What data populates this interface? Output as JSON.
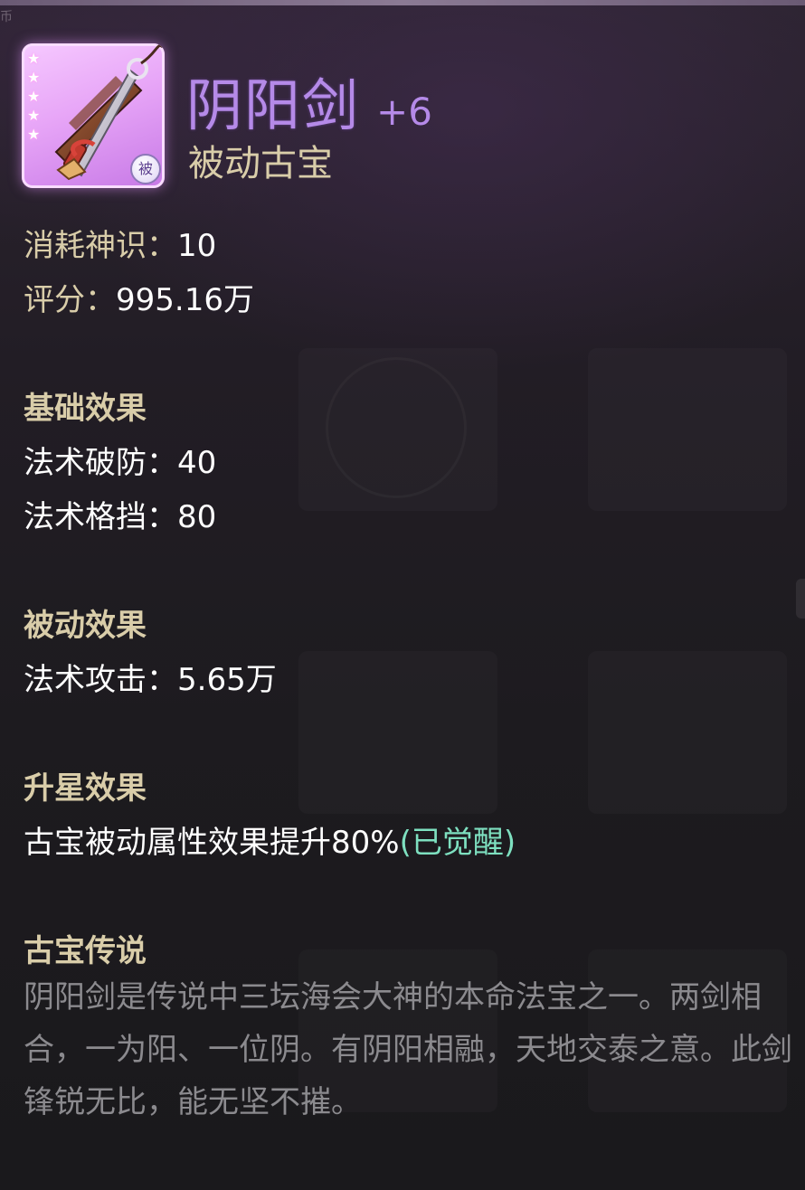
{
  "corner_mark": "币",
  "item": {
    "name": "阴阳剑",
    "level": "+6",
    "type": "被动古宝",
    "stars": [
      "★",
      "★",
      "★",
      "★",
      "★"
    ],
    "badge": "被"
  },
  "stats": {
    "cost_label": "消耗神识：",
    "cost_value": "10",
    "score_label": "评分：",
    "score_value": "995.16万"
  },
  "basic": {
    "heading": "基础效果",
    "items": [
      {
        "label": "法术破防：",
        "value": "40"
      },
      {
        "label": "法术格挡：",
        "value": "80"
      }
    ]
  },
  "passive": {
    "heading": "被动效果",
    "items": [
      {
        "label": "法术攻击：",
        "value": "5.65万"
      }
    ]
  },
  "star_up": {
    "heading": "升星效果",
    "text": "古宝被动属性效果提升80%",
    "status": "(已觉醒)"
  },
  "lore": {
    "heading": "古宝传说",
    "text": "阴阳剑是传说中三坛海会大神的本命法宝之一。两剑相合，一为阳、一位阴。有阴阳相融，天地交泰之意。此剑锋锐无比，能无坚不摧。"
  },
  "colors": {
    "title": "#b58ae8",
    "label": "#d9cda9",
    "value": "#ffffff",
    "awakened": "#7ee0c0",
    "lore": "#8b8a8e"
  }
}
